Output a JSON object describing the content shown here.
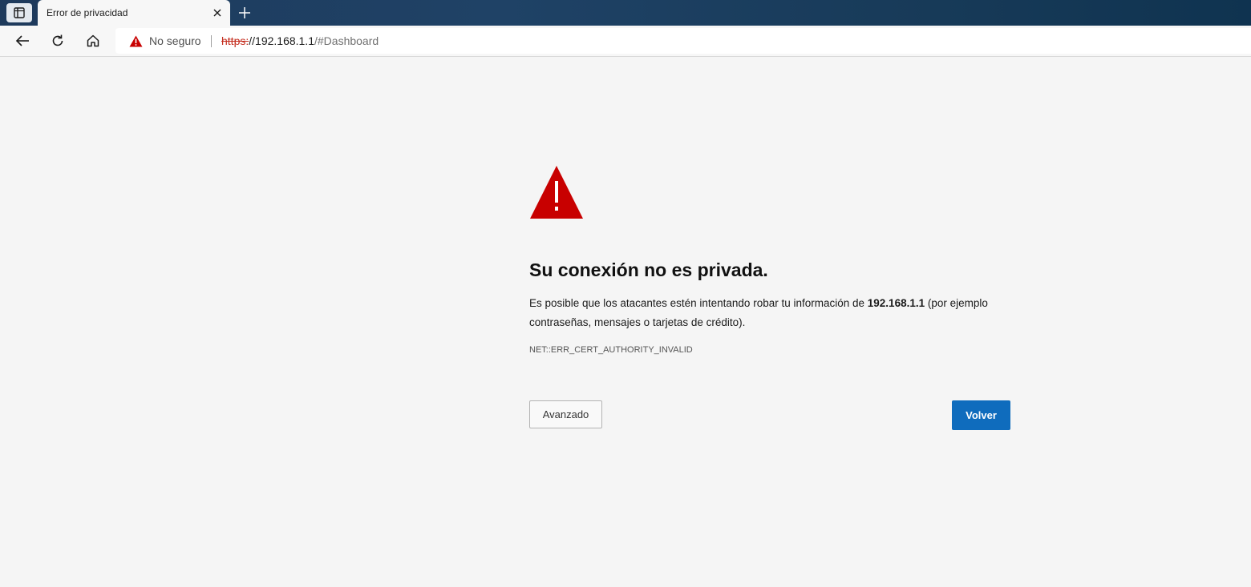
{
  "browser": {
    "tab": {
      "title": "Error de privacidad"
    },
    "address": {
      "security_label": "No seguro",
      "url_scheme": "https:",
      "url_host": "//192.168.1.1",
      "url_path": "/#Dashboard"
    },
    "icons": [
      "tab-actions-icon",
      "close-icon",
      "plus-icon",
      "back-arrow-icon",
      "refresh-icon",
      "home-icon",
      "warning-icon"
    ]
  },
  "page": {
    "heading": "Su conexión no es privada.",
    "description_before": "Es posible que los atacantes estén intentando robar tu información de ",
    "description_host": "192.168.1.1",
    "description_after": " (por ejemplo contraseñas, mensajes o tarjetas de crédito).",
    "error_code": "NET::ERR_CERT_AUTHORITY_INVALID",
    "advanced_label": "Avanzado",
    "back_label": "Volver"
  },
  "colors": {
    "warning_red": "#c80000",
    "primary_button": "#0f6cbd",
    "page_background": "#f5f5f5",
    "tabstrip": "#1f4266"
  }
}
